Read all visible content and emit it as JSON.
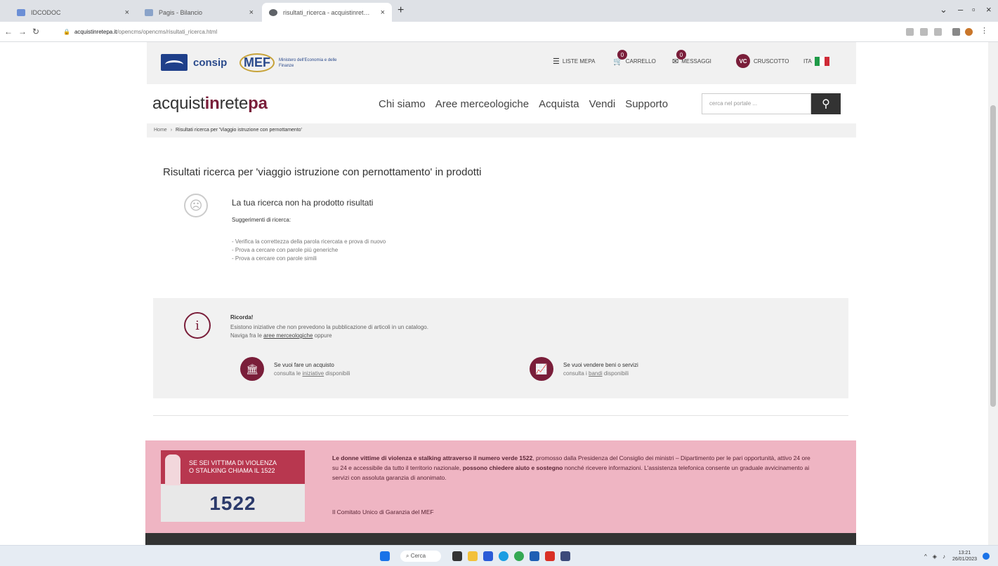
{
  "browser": {
    "tabs": [
      {
        "label": "IDCODOC",
        "active": false
      },
      {
        "label": "Pagis - Bilancio",
        "active": false
      },
      {
        "label": "risultati_ricerca - acquistinret…",
        "active": true
      }
    ],
    "url_host": "acquistinretepa.it",
    "url_path": "/opencms/opencms/risultati_ricerca.html"
  },
  "topbar": {
    "consip": "consip",
    "mef_mark": "MEF",
    "mef_text": "Ministero dell'Economia e delle Finanze",
    "liste": "LISTE MEPA",
    "carrello": "CARRELLO",
    "carrello_count": "0",
    "messaggi": "MESSAGGI",
    "messaggi_count": "0",
    "user_initials": "VC",
    "cruscotto": "CRUSCOTTO",
    "lang": "ITA"
  },
  "brand": {
    "part1": "acquist",
    "part2": "in",
    "part3": "rete",
    "part4": "pa"
  },
  "nav": [
    "Chi siamo",
    "Aree merceologiche",
    "Acquista",
    "Vendi",
    "Supporto"
  ],
  "search": {
    "placeholder": "cerca nel portale ..."
  },
  "breadcrumb": {
    "home": "Home",
    "current": "Risultati ricerca per 'Viaggio istruzione con pernottamento'"
  },
  "results": {
    "title": "Risultati ricerca per 'viaggio istruzione con pernottamento' in prodotti",
    "no_results": "La tua ricerca non ha prodotto risultati",
    "suggest_title": "Suggerimenti di ricerca:",
    "suggestions": [
      "- Verifica la correttezza della parola ricercata e prova di nuovo",
      "- Prova a cercare con parole più generiche",
      "- Prova a cercare con parole simili"
    ]
  },
  "info": {
    "ricorda": "Ricorda!",
    "line1": "Esistono iniziative che non prevedono la pubblicazione di articoli in un catalogo.",
    "line2_pre": "Naviga fra le",
    "line2_link": "aree merceologiche",
    "line2_post": "oppure",
    "buy_title": "Se vuoi fare un acquisto",
    "buy_pre": "consulta le",
    "buy_link": "iniziative",
    "buy_post": "disponibili",
    "sell_title": "Se vuoi vendere beni o servizi",
    "sell_pre": "consulta i",
    "sell_link": "bandi",
    "sell_post": "disponibili"
  },
  "violence": {
    "card_line1": "SE SEI VITTIMA DI VIOLENZA",
    "card_line2": "O STALKING CHIAMA IL 1522",
    "card_number": "1522",
    "text_bold1": "Le donne vittime di violenza e stalking attraverso il numero verde 1522",
    "text_1": ", promosso dalla Presidenza del Consiglio dei ministri – Dipartimento per le pari opportunità, attivo 24 ore su 24 e accessibile da tutto il territorio nazionale, ",
    "text_bold2": "possono chiedere aiuto e sostegno",
    "text_2": " nonché ricevere informazioni. L'assistenza telefonica consente un graduale avvicinamento ai servizi con assoluta garanzia di anonimato.",
    "sign": "Il Comitato Unico di Garanzia del MEF"
  },
  "taskbar": {
    "search": "Cerca",
    "time": "13:21",
    "date": "26/01/2023"
  },
  "colors": {
    "accent": "#7a1e3a",
    "pink_banner": "#efb5c3"
  }
}
